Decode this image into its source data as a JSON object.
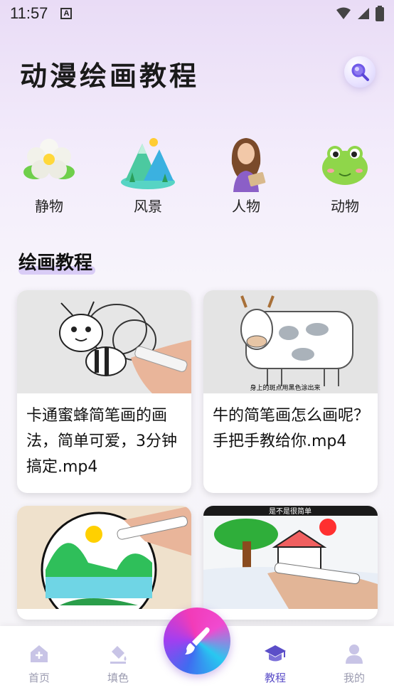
{
  "status_bar": {
    "time": "11:57",
    "badge": "A"
  },
  "header": {
    "title": "动漫绘画教程"
  },
  "categories": [
    {
      "label": "静物",
      "icon": "flower-icon"
    },
    {
      "label": "风景",
      "icon": "mountain-icon"
    },
    {
      "label": "人物",
      "icon": "person-icon"
    },
    {
      "label": "动物",
      "icon": "frog-icon"
    }
  ],
  "section": {
    "title": "绘画教程"
  },
  "videos": [
    {
      "title": "卡通蜜蜂简笔画的画法，简单可爱，3分钟搞定.mp4"
    },
    {
      "title": "牛的简笔画怎么画呢？手把手教给你.mp4",
      "thumb_caption": "身上的斑点用黑色涂出来"
    },
    {
      "title": ""
    },
    {
      "title": "",
      "thumb_caption": "是不是很简单"
    }
  ],
  "bottom_nav": [
    {
      "label": "首页",
      "icon": "home-icon"
    },
    {
      "label": "填色",
      "icon": "paint-bucket-icon"
    },
    {
      "label": "教程",
      "icon": "graduation-cap-icon",
      "active": true
    },
    {
      "label": "我的",
      "icon": "user-icon"
    }
  ],
  "colors": {
    "accent": "#5b4ec8",
    "nav_inactive": "#9b9bb0"
  }
}
